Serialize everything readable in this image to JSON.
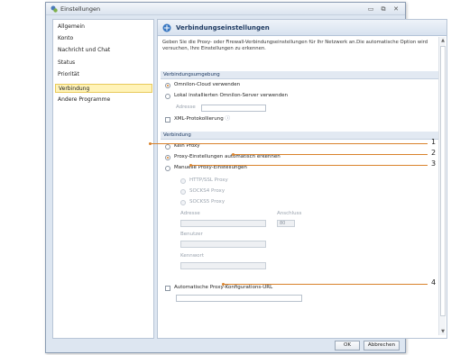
{
  "window": {
    "title": "Einstellungen",
    "controls": {
      "minimize": "▭",
      "restore": "⧉",
      "close": "✕"
    }
  },
  "sidebar": {
    "items": [
      {
        "label": "Allgemein"
      },
      {
        "label": "Konto"
      },
      {
        "label": "Nachricht und Chat"
      },
      {
        "label": "Status"
      },
      {
        "label": "Priorität"
      },
      {
        "label": "Verbindung",
        "selected": true
      },
      {
        "label": "Andere Programme"
      }
    ]
  },
  "main": {
    "title": "Verbindungseinstellungen",
    "intro": "Geben Sie die Proxy- oder Firewall-Verbindungseinstellungen für Ihr Netzwerk an.Die automatische Option wird versuchen, Ihre Einstellungen zu erkennen.",
    "section_env": {
      "title": "Verbindungsumgebung",
      "cloud": "Omnilon-Cloud verwenden",
      "local": "Lokal installierten Omnilon-Server verwenden",
      "address_label": "Adresse",
      "address_value": "",
      "xml_logging": "XML-Protokollierung",
      "info_icon": "ⓘ"
    },
    "section_conn": {
      "title": "Verbindung",
      "no_proxy": "Kein Proxy",
      "auto_detect": "Proxy-Einstellungen automatisch erkennen",
      "manual": "Manuelle Proxy-Einstellungen",
      "proxy_types": [
        "HTTP/SSL Proxy",
        "SOCKS4 Proxy",
        "SOCKS5 Proxy"
      ],
      "address_label": "Adresse",
      "port_label": "Anschluss",
      "port_value": "80",
      "user_label": "Benutzer",
      "password_label": "Kennwort",
      "auto_config_url": "Automatische Proxy-Konfigurations-URL",
      "auto_config_value": ""
    }
  },
  "footer": {
    "ok": "OK",
    "cancel": "Abbrechen"
  },
  "callouts": [
    "1",
    "2",
    "3",
    "4"
  ],
  "colors": {
    "accent": "#d9822b",
    "selection": "#fff3b8",
    "header": "#1f3b62"
  }
}
